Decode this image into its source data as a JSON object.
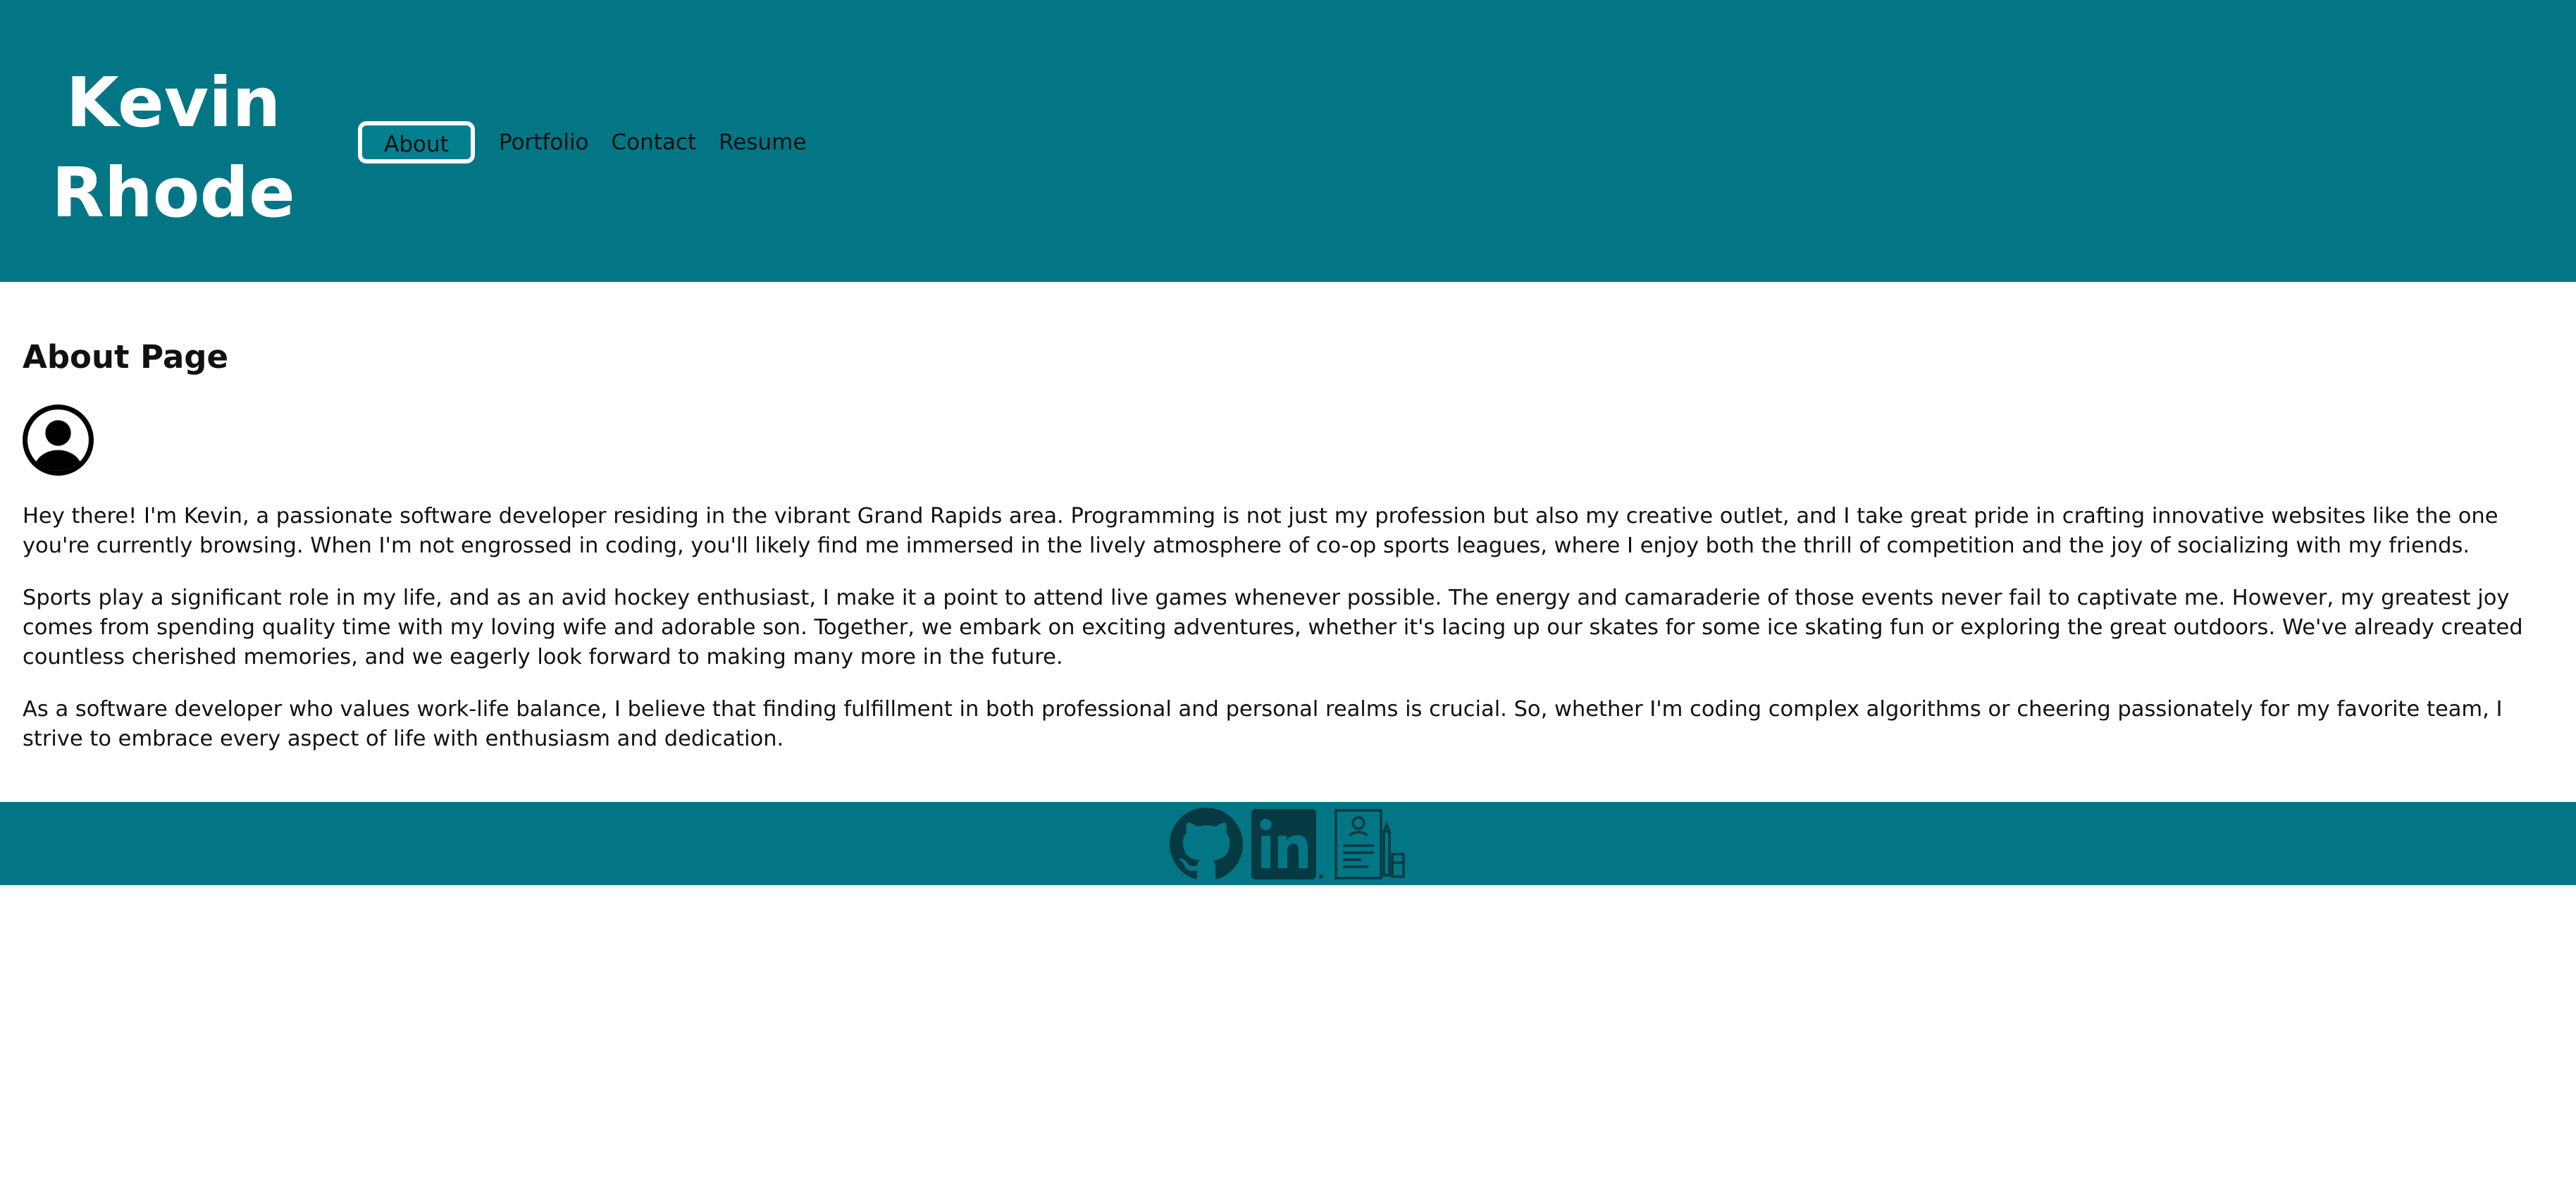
{
  "header": {
    "name_line1": "Kevin",
    "name_line2": "Rhode",
    "background": "#027685",
    "nav": [
      {
        "label": "About",
        "active": true
      },
      {
        "label": "Portfolio",
        "active": false
      },
      {
        "label": "Contact",
        "active": false
      },
      {
        "label": "Resume",
        "active": false
      }
    ]
  },
  "main": {
    "title": "About Page",
    "avatar_icon": "user-avatar-icon",
    "paragraphs": [
      "Hey there! I'm Kevin, a passionate software developer residing in the vibrant Grand Rapids area. Programming is not just my profession but also my creative outlet, and I take great pride in crafting innovative websites like the one you're currently browsing. When I'm not engrossed in coding, you'll likely find me immersed in the lively atmosphere of co-op sports leagues, where I enjoy both the thrill of competition and the joy of socializing with my friends.",
      "Sports play a significant role in my life, and as an avid hockey enthusiast, I make it a point to attend live games whenever possible. The energy and camaraderie of those events never fail to captivate me. However, my greatest joy comes from spending quality time with my loving wife and adorable son. Together, we embark on exciting adventures, whether it's lacing up our skates for some ice skating fun or exploring the great outdoors. We've already created countless cherished memories, and we eagerly look forward to making many more in the future.",
      "As a software developer who values work-life balance, I believe that finding fulfillment in both professional and personal realms is crucial. So, whether I'm coding complex algorithms or cheering passionately for my favorite team, I strive to embrace every aspect of life with enthusiasm and dedication."
    ]
  },
  "footer": {
    "background": "#027685",
    "icons": [
      "github-icon",
      "linkedin-icon",
      "resume-icon"
    ]
  }
}
